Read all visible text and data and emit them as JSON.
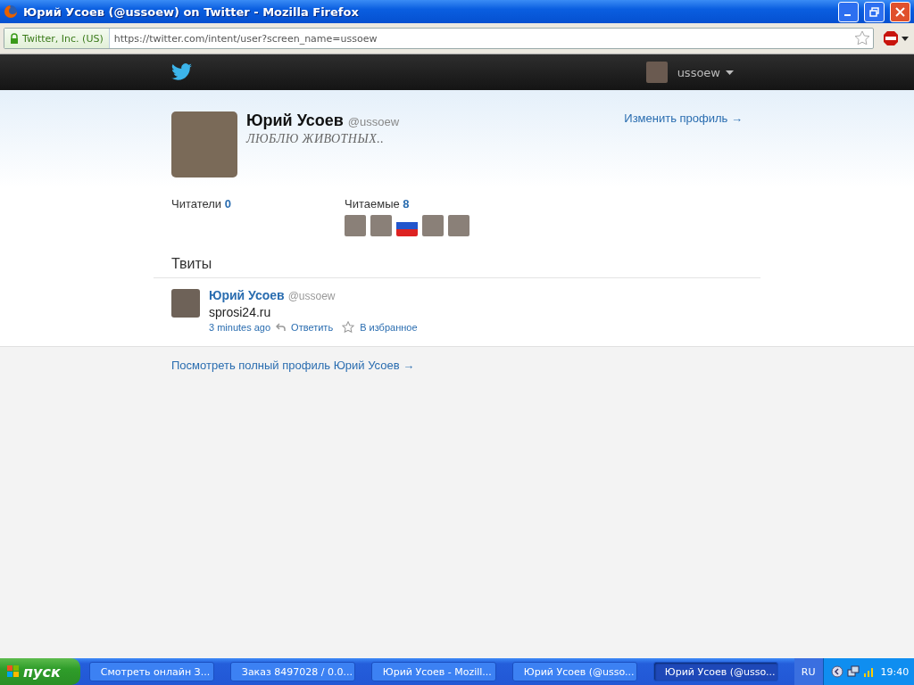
{
  "window": {
    "title": "Юрий Усоев (@ussoew) on Twitter - Mozilla Firefox"
  },
  "address_bar": {
    "identity": "Twitter, Inc. (US)",
    "url": "https://twitter.com/intent/user?screen_name=ussoew"
  },
  "top_bar": {
    "username": "ussoew"
  },
  "profile": {
    "name": "Юрий Усоев",
    "handle": "@ussoew",
    "bio": "ЛЮБЛЮ ЖИВОТНЫХ..",
    "edit_link": "Изменить профиль →",
    "followers": {
      "label": "Читатели",
      "count": "0"
    },
    "following": {
      "label": "Читаемые",
      "count": "8"
    }
  },
  "tweets_heading": "Твиты",
  "tweets": [
    {
      "name": "Юрий Усоев",
      "handle": "@ussoew",
      "text": "sprosi24.ru",
      "time": "3 minutes ago",
      "reply": "Ответить",
      "favorite": "В избранное"
    }
  ],
  "full_profile_link": "Посмотреть полный профиль Юрий Усоев →",
  "taskbar": {
    "start": "пуск",
    "items": [
      {
        "label": "Смотреть онлайн З...",
        "selected": false
      },
      {
        "label": "Заказ 8497028 / 0.0...",
        "selected": false
      },
      {
        "label": "Юрий Усоев - Mozill...",
        "selected": false
      },
      {
        "label": "Юрий Усоев (@usso...",
        "selected": false
      },
      {
        "label": "Юрий Усоев (@usso...",
        "selected": true
      }
    ],
    "language": "RU",
    "clock": "19:40"
  }
}
